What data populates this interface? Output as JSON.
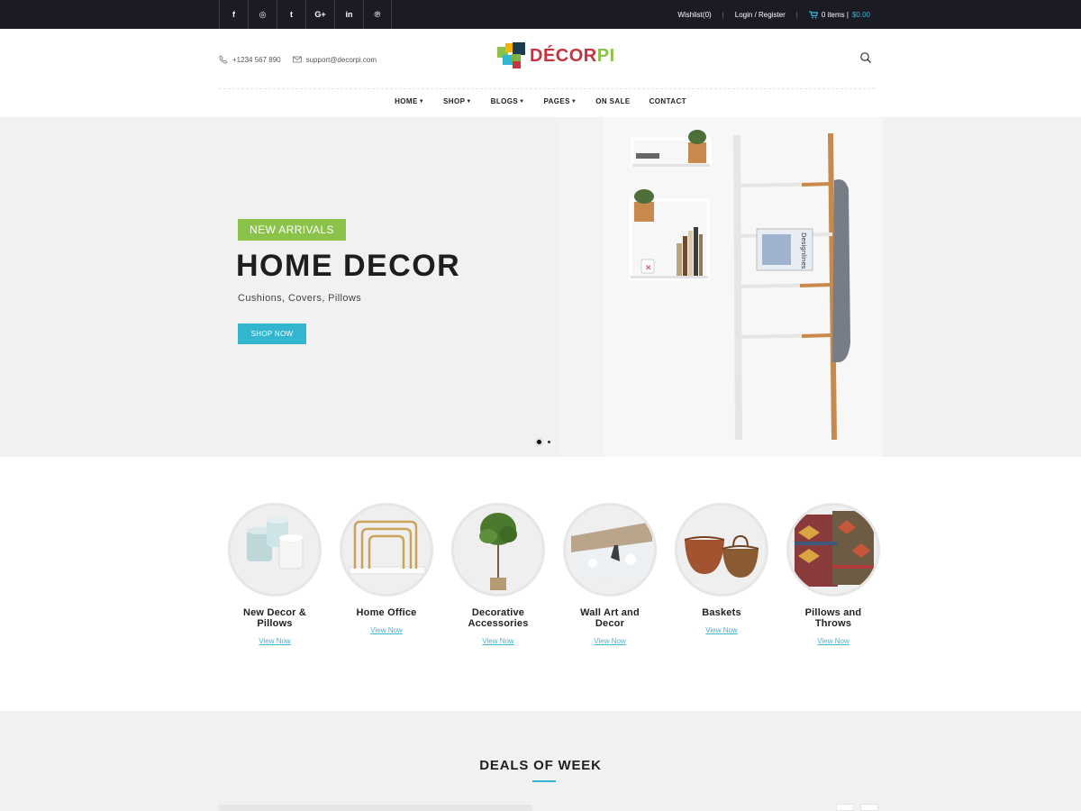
{
  "topbar": {
    "socials": [
      {
        "icon": "facebook-icon",
        "glyph": "f"
      },
      {
        "icon": "instagram-icon",
        "glyph": "◎"
      },
      {
        "icon": "twitter-icon",
        "glyph": "t"
      },
      {
        "icon": "google-plus-icon",
        "glyph": "G+"
      },
      {
        "icon": "linkedin-icon",
        "glyph": "in"
      },
      {
        "icon": "pinterest-icon",
        "glyph": "℗"
      }
    ],
    "wishlist": "Wishlist(0)",
    "login": "Login / Register",
    "cart_items": "0 items |",
    "cart_total": "$0.00"
  },
  "header": {
    "phone": "+1234 567 890",
    "email": "support@decorpi.com",
    "logo_part1": "DÉCOR",
    "logo_part2": "PI"
  },
  "nav": [
    {
      "label": "HOME",
      "dropdown": true
    },
    {
      "label": "SHOP",
      "dropdown": true
    },
    {
      "label": "BLOGS",
      "dropdown": true
    },
    {
      "label": "PAGES",
      "dropdown": true
    },
    {
      "label": "ON SALE",
      "dropdown": false
    },
    {
      "label": "CONTACT",
      "dropdown": false
    }
  ],
  "hero": {
    "badge": "NEW ARRIVALS",
    "title": "HOME DECOR",
    "subtitle": "Cushions, Covers, Pillows",
    "button": "SHOP NOW",
    "magazine_text": "Designlines",
    "slides_count": 2,
    "active_slide": 1
  },
  "categories": [
    {
      "name": "New Decor & Pillows",
      "link": "View Now"
    },
    {
      "name": "Home Office",
      "link": "View Now"
    },
    {
      "name": "Decorative Accessories",
      "link": "View Now"
    },
    {
      "name": "Wall Art and Decor",
      "link": "View Now"
    },
    {
      "name": "Baskets",
      "link": "View Now"
    },
    {
      "name": "Pillows and Throws",
      "link": "View Now"
    }
  ],
  "deals": {
    "title": "DEALS OF WEEK"
  },
  "colors": {
    "topbar_bg": "#1b1b24",
    "accent_blue": "#33b5cf",
    "accent_green": "#8bc34a",
    "logo_red": "#c4333f"
  }
}
